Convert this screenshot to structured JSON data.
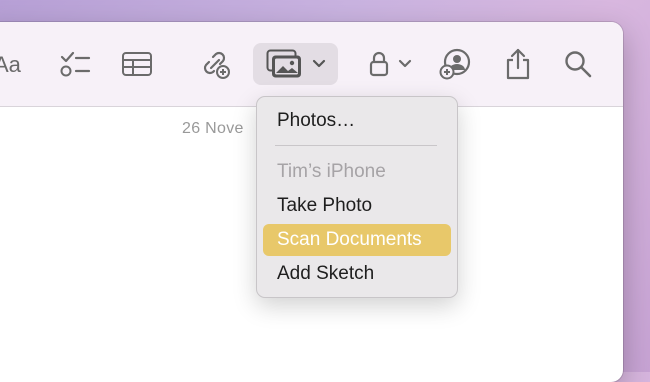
{
  "toolbar": {
    "format_label": "Aa",
    "icons": [
      "checklist-icon",
      "table-icon",
      "link-icon",
      "photo-library-icon",
      "chevron-down-icon",
      "lock-icon",
      "collaborate-icon",
      "share-icon",
      "search-icon"
    ]
  },
  "note": {
    "date_partial": "26 Nove"
  },
  "menu": {
    "items": [
      {
        "label": "Photos…",
        "type": "item"
      },
      {
        "label": "Tim’s iPhone",
        "type": "header"
      },
      {
        "label": "Take Photo",
        "type": "item"
      },
      {
        "label": "Scan Documents",
        "type": "item",
        "selected": true
      },
      {
        "label": "Add Sketch",
        "type": "item"
      }
    ]
  },
  "colors": {
    "highlight": "#e8c86a",
    "toolbar_bg": "#f7f1f8",
    "menu_bg": "#eae8ea"
  }
}
